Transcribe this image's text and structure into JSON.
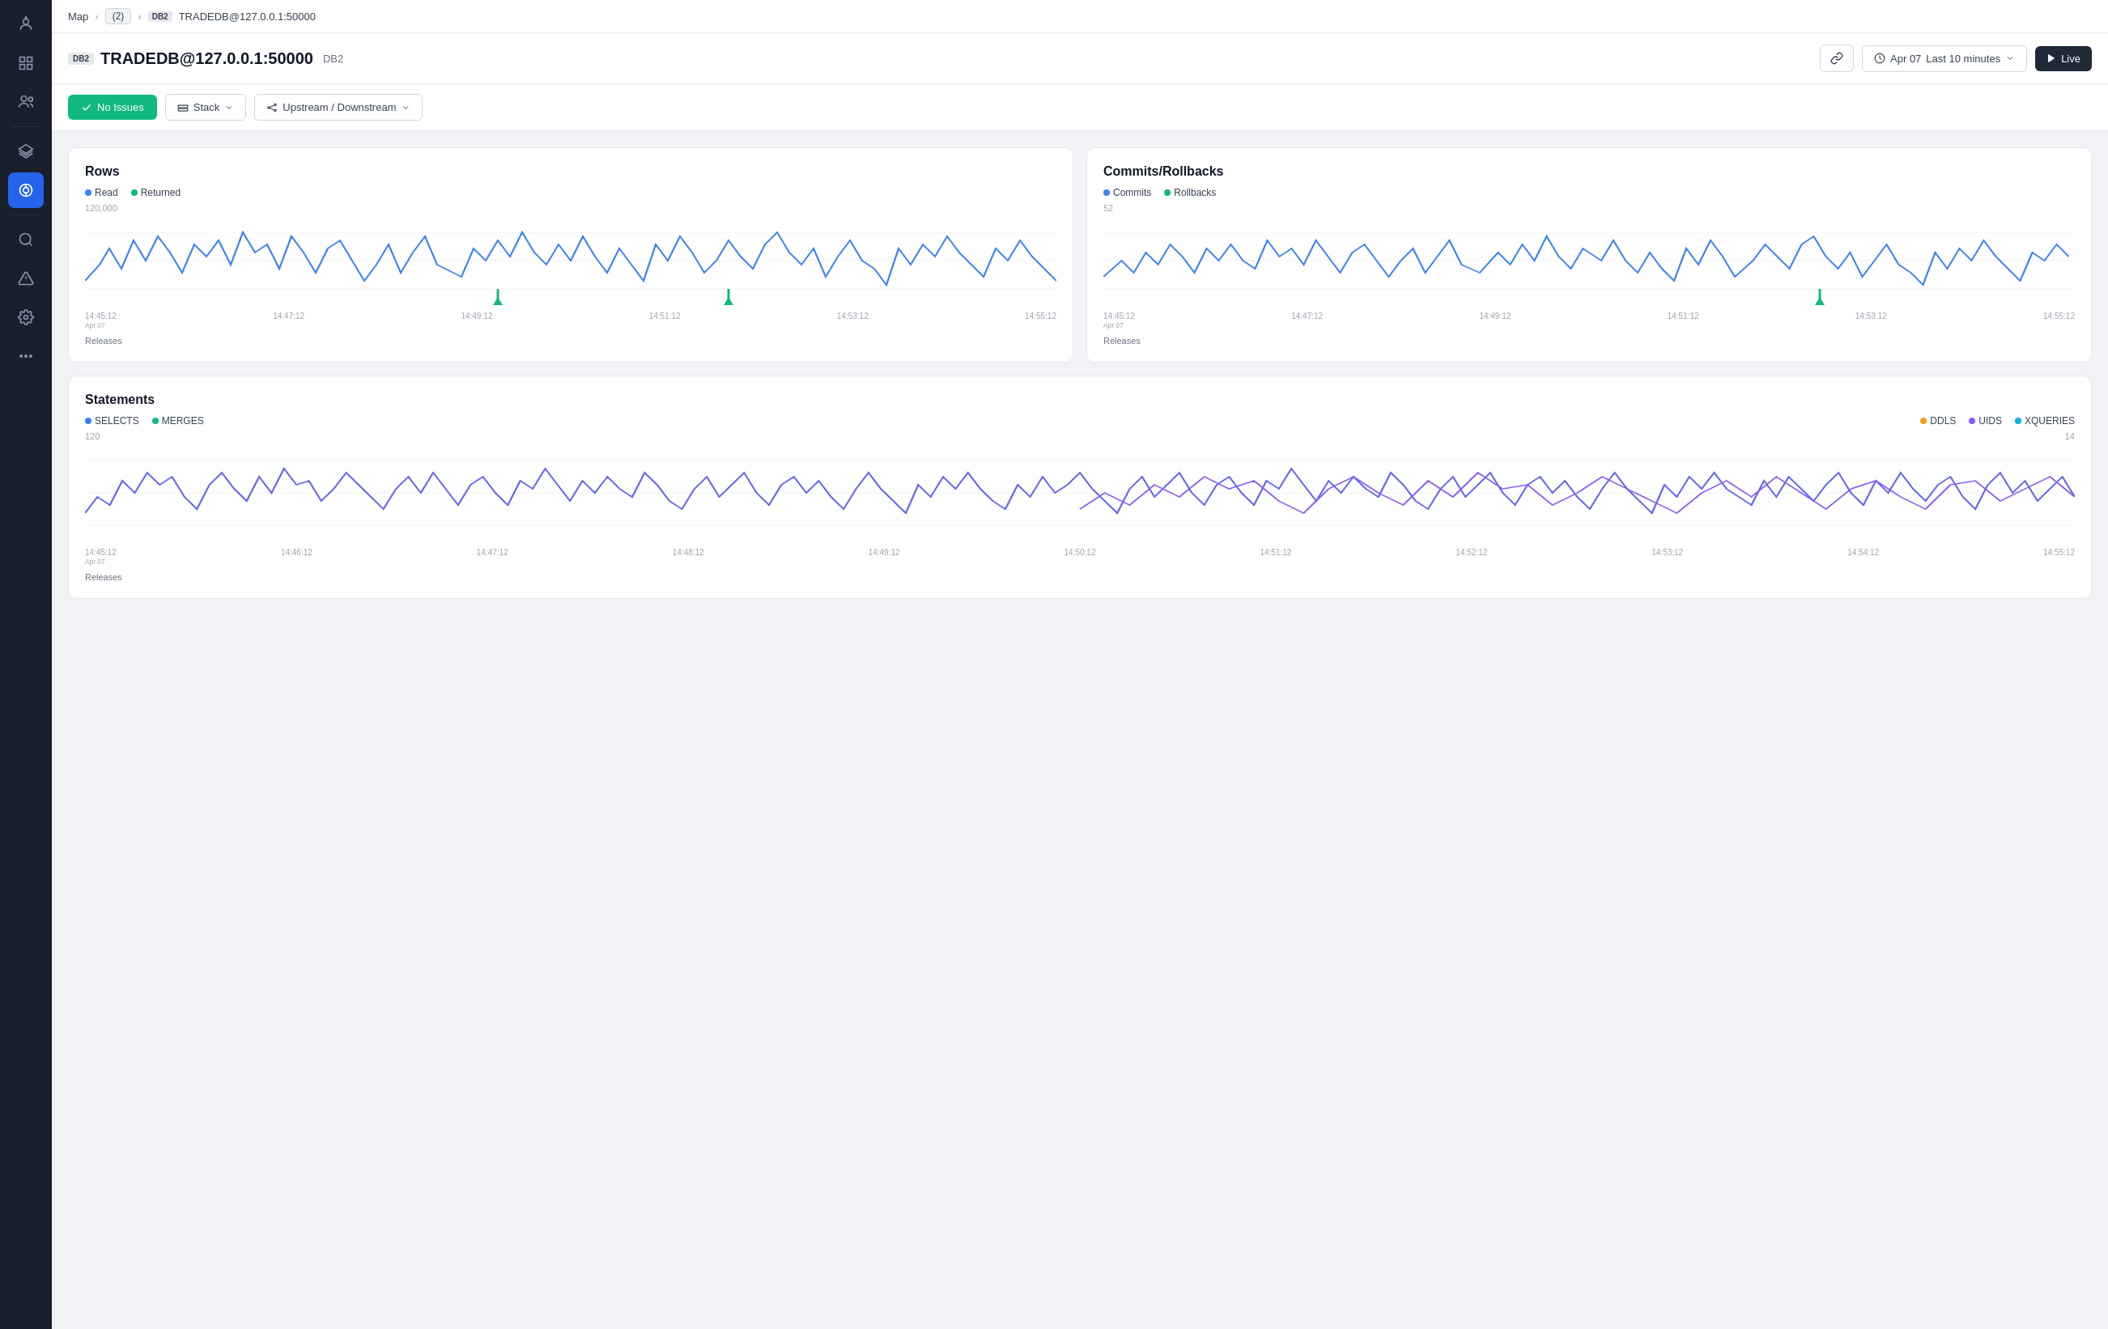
{
  "sidebar": {
    "icons": [
      {
        "name": "robot-icon",
        "symbol": "🤖",
        "active": false
      },
      {
        "name": "grid-icon",
        "symbol": "⊞",
        "active": false
      },
      {
        "name": "users-icon",
        "symbol": "👥",
        "active": false
      },
      {
        "name": "layers-icon",
        "symbol": "◉",
        "active": false
      },
      {
        "name": "stack-icon",
        "symbol": "🔷",
        "active": true
      },
      {
        "name": "search-icon",
        "symbol": "🔍",
        "active": false
      },
      {
        "name": "warning-icon",
        "symbol": "⚠",
        "active": false
      },
      {
        "name": "settings-icon",
        "symbol": "⚙",
        "active": false
      },
      {
        "name": "more-icon",
        "symbol": "···",
        "active": false
      }
    ]
  },
  "breadcrumb": {
    "map_label": "Map",
    "dots_label": "(2)",
    "db2_badge": "DB2",
    "current": "TRADEDB@127.0.0.1:50000"
  },
  "header": {
    "db2_badge": "DB2",
    "title": "TRADEDB@127.0.0.1:50000",
    "subtitle": "DB2",
    "link_icon": "🔗",
    "time_icon": "🕐",
    "date": "Apr 07",
    "time_range": "Last 10 minutes",
    "live_label": "Live"
  },
  "toolbar": {
    "no_issues_label": "No Issues",
    "stack_label": "Stack",
    "upstream_label": "Upstream / Downstream"
  },
  "rows_chart": {
    "title": "Rows",
    "legend": [
      {
        "label": "Read",
        "color": "#3b82f6"
      },
      {
        "label": "Returned",
        "color": "#10b981"
      }
    ],
    "ymax": "120,000",
    "xaxis": [
      "14:45:12\nApr 07",
      "14:47:12",
      "14:49:12",
      "14:51:12",
      "14:53:12",
      "14:55:12"
    ],
    "footer": "Releases"
  },
  "commits_chart": {
    "title": "Commits/Rollbacks",
    "legend": [
      {
        "label": "Commits",
        "color": "#3b82f6"
      },
      {
        "label": "Rollbacks",
        "color": "#10b981"
      }
    ],
    "ymax": "52",
    "xaxis": [
      "14:45:12\nApr 07",
      "14:47:12",
      "14:49:12",
      "14:51:12",
      "14:53:12",
      "14:55:12"
    ],
    "footer": "Releases"
  },
  "statements_chart": {
    "title": "Statements",
    "legend_left": [
      {
        "label": "SELECTS",
        "color": "#3b82f6"
      },
      {
        "label": "MERGES",
        "color": "#10b981"
      }
    ],
    "legend_right": [
      {
        "label": "DDLS",
        "color": "#f59e0b"
      },
      {
        "label": "UIDS",
        "color": "#8b5cf6"
      },
      {
        "label": "XQUERIES",
        "color": "#06b6d4"
      }
    ],
    "ymax_left": "120",
    "ymax_right": "14",
    "xaxis": [
      "14:45:12\nApr 07",
      "14:46:12",
      "14:47:12",
      "14:48:12",
      "14:49:12",
      "14:50:12",
      "14:51:12",
      "14:52:12",
      "14:53:12",
      "14:54:12",
      "14:55:12"
    ],
    "footer": "Releases"
  }
}
